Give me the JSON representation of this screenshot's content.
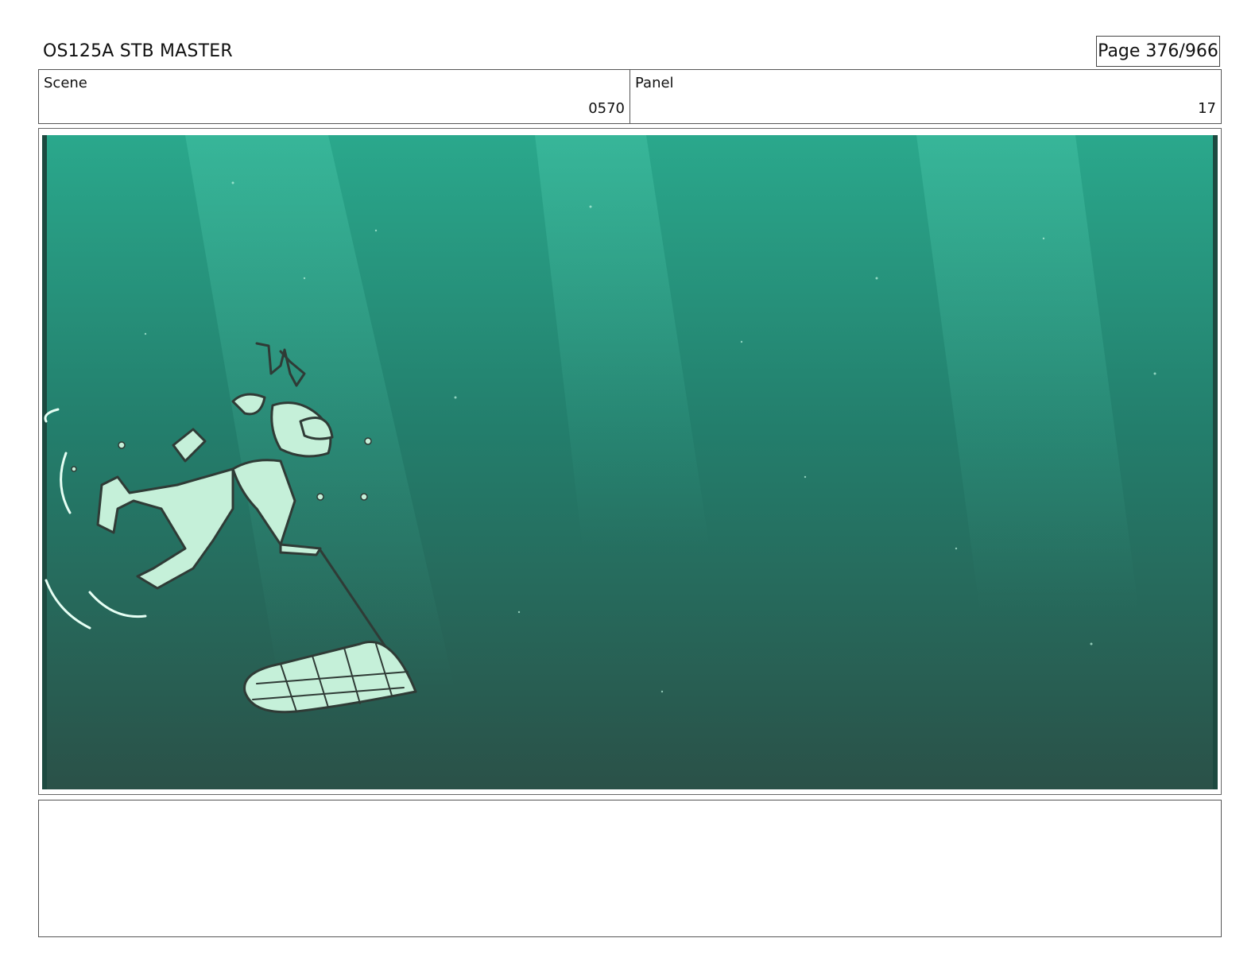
{
  "header": {
    "title": "OS125A STB MASTER",
    "page": "Page 376/966"
  },
  "info": {
    "scene_label": "Scene",
    "scene_value": "0570",
    "panel_label": "Panel",
    "panel_value": "17"
  },
  "panel": {
    "description_icon": "underwater-storyboard-drawing",
    "colors": {
      "water_top": "#2aa88c",
      "water_bottom": "#2a5148",
      "character_fill": "#c5f0d9",
      "linework": "#2f3b36"
    }
  },
  "notes": {
    "text": ""
  }
}
